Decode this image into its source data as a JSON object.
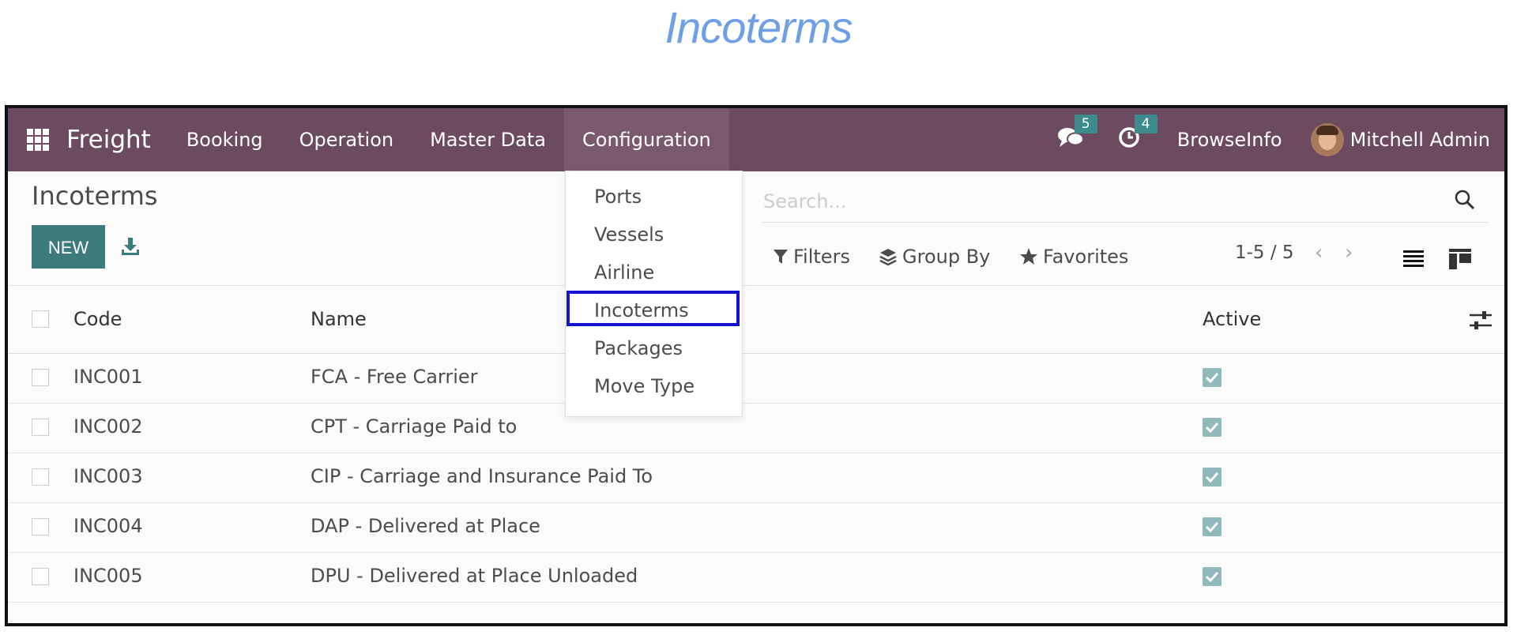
{
  "doc_title": "Incoterms",
  "navbar": {
    "brand": "Freight",
    "menu": [
      {
        "label": "Booking"
      },
      {
        "label": "Operation"
      },
      {
        "label": "Master Data"
      },
      {
        "label": "Configuration",
        "active": true
      }
    ],
    "messages_count": "5",
    "activities_count": "4",
    "company": "BrowseInfo",
    "user": "Mitchell Admin"
  },
  "control_panel": {
    "title": "Incoterms",
    "new_label": "NEW",
    "search_placeholder": "Search...",
    "filters_label": "Filters",
    "group_by_label": "Group By",
    "favorites_label": "Favorites",
    "pager": "1-5 / 5"
  },
  "table": {
    "headers": {
      "code": "Code",
      "name": "Name",
      "active": "Active"
    },
    "rows": [
      {
        "code": "INC001",
        "name": "FCA - Free Carrier",
        "active": true
      },
      {
        "code": "INC002",
        "name": "CPT - Carriage Paid to",
        "active": true
      },
      {
        "code": "INC003",
        "name": "CIP - Carriage and Insurance Paid To",
        "active": true
      },
      {
        "code": "INC004",
        "name": "DAP - Delivered at Place",
        "active": true
      },
      {
        "code": "INC005",
        "name": "DPU - Delivered at Place Unloaded",
        "active": true
      }
    ]
  },
  "dropdown": {
    "items": [
      "Ports",
      "Vessels",
      "Airline",
      "Incoterms",
      "Packages",
      "Move Type"
    ],
    "highlighted": "Incoterms"
  },
  "colors": {
    "navbar": "#6c4a60",
    "primary": "#3d7a7c",
    "highlight_border": "#1414d0",
    "title": "#6fa0e6"
  }
}
